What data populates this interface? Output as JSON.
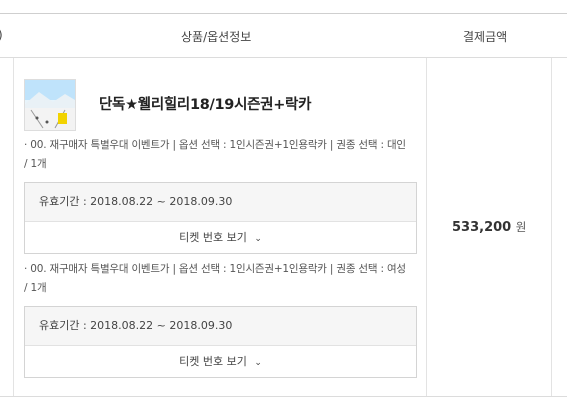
{
  "header": {
    "left_fragment": ")",
    "product_col": "상품/옵션정보",
    "payment_col": "결제금액"
  },
  "product": {
    "title": "단독★웰리힐리18/19시즌권+락카",
    "thumb_icon": "product-thumbnail"
  },
  "options": [
    {
      "bullet": "·",
      "text": "00. 재구매자 특별우대 이벤트가 | 옵션 선택 : 1인시즌권+1인용락카 | 권종 선택 : 대인 / 1개",
      "validity": "유효기간 : 2018.08.22 ~ 2018.09.30",
      "ticket_button": "티켓 번호 보기"
    },
    {
      "bullet": "·",
      "text": "00. 재구매자 특별우대 이벤트가 | 옵션 선택 : 1인시즌권+1인용락카 | 권종 선택 : 여성 / 1개",
      "validity": "유효기간 : 2018.08.22 ~ 2018.09.30",
      "ticket_button": "티켓 번호 보기"
    }
  ],
  "payment": {
    "amount": "533,200",
    "unit": "원"
  }
}
